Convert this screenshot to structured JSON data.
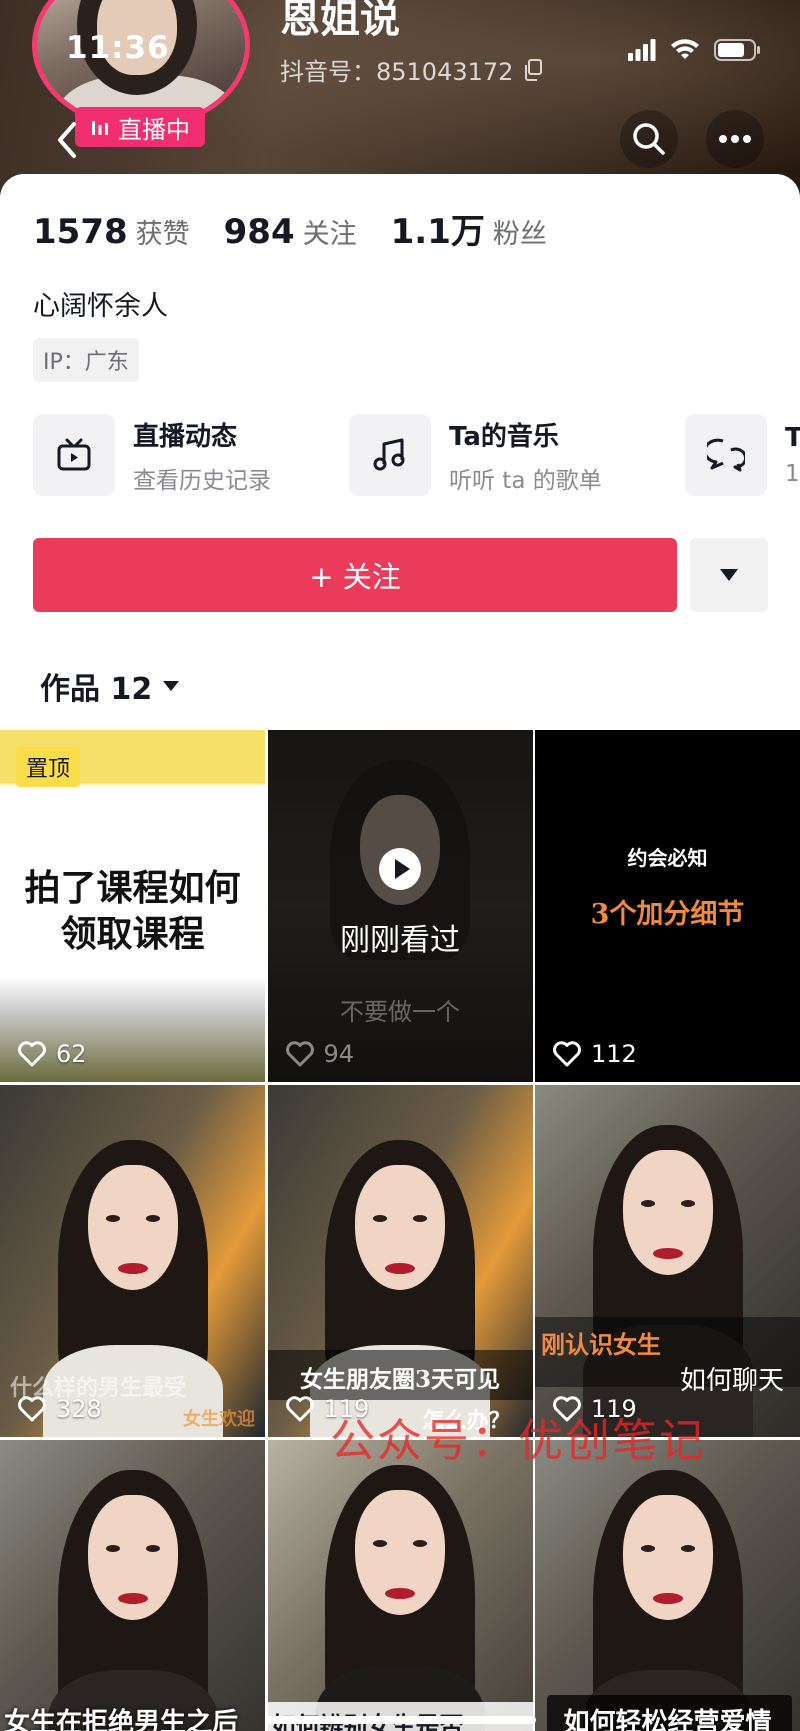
{
  "status_bar": {
    "time": "11:36"
  },
  "profile": {
    "name": "恩姐说",
    "douyin_id": "抖音号：851043172",
    "live_badge": "直播中",
    "bio": "心阔怀余人",
    "ip": "IP：广东"
  },
  "stats": [
    {
      "value": "1578",
      "label": "获赞"
    },
    {
      "value": "984",
      "label": "关注"
    },
    {
      "value": "1.1万",
      "label": "粉丝"
    }
  ],
  "shortcuts": [
    {
      "icon": "tv-icon",
      "title": "直播动态",
      "subtitle": "查看历史记录"
    },
    {
      "icon": "music-icon",
      "title": "Ta的音乐",
      "subtitle": "听听 ta 的歌单"
    },
    {
      "icon": "chat-icon",
      "title": "T",
      "subtitle": "1"
    }
  ],
  "actions": {
    "follow_label": "+ 关注"
  },
  "works": {
    "tab_label": "作品 12"
  },
  "videos": [
    {
      "likes": "62",
      "pinned_label": "置顶",
      "caption": "拍了课程如何\n领取课程"
    },
    {
      "likes": "94",
      "overlay": "刚刚看过",
      "caption": "不要做一个"
    },
    {
      "likes": "112",
      "caption_top": "约会必知",
      "caption": "3个加分细节"
    },
    {
      "likes": "328",
      "caption": "什么样的男生最受",
      "caption2": "女生欢迎"
    },
    {
      "likes": "119",
      "caption": "女生朋友圈3天可见",
      "caption2": "怎么办？"
    },
    {
      "likes": "119",
      "caption": "刚认识女生",
      "caption2": "如何聊天"
    },
    {
      "likes": "",
      "caption": "女生在拒绝男生之后"
    },
    {
      "likes": "",
      "caption": "如何辨别女生是否"
    },
    {
      "likes": "",
      "caption": "如何轻松经营爱情"
    }
  ],
  "watermark": "公众号：优创笔记",
  "colors": {
    "accent": "#ea3b5b",
    "live": "#f12e6f",
    "pinned": "#fadd4a"
  }
}
